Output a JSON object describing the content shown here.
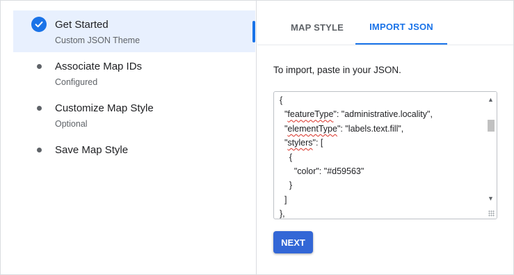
{
  "stepper": {
    "steps": [
      {
        "title": "Get Started",
        "subtitle": "Custom JSON Theme",
        "status": "completed",
        "icon": "check-circle-icon"
      },
      {
        "title": "Associate Map IDs",
        "subtitle": "Configured",
        "status": "pending",
        "icon": "bullet-icon"
      },
      {
        "title": "Customize Map Style",
        "subtitle": "Optional",
        "status": "pending",
        "icon": "bullet-icon"
      },
      {
        "title": "Save Map Style",
        "subtitle": "",
        "status": "pending",
        "icon": "bullet-icon"
      }
    ]
  },
  "tabs": [
    {
      "label": "MAP STYLE",
      "selected": false
    },
    {
      "label": "IMPORT JSON",
      "selected": true
    }
  ],
  "instruction": "To import, paste in your JSON.",
  "json_editor": {
    "lines": [
      "{",
      "  \"featureType\": \"administrative.locality\",",
      "  \"elementType\": \"labels.text.fill\",",
      "  \"stylers\": [",
      "    {",
      "      \"color\": \"#d59563\"",
      "    }",
      "  ]",
      "},"
    ]
  },
  "next_button": {
    "label": "NEXT"
  },
  "colors": {
    "accent": "#1a73e8",
    "button": "#3367d6",
    "active_step_bg": "#e8f0fe"
  }
}
